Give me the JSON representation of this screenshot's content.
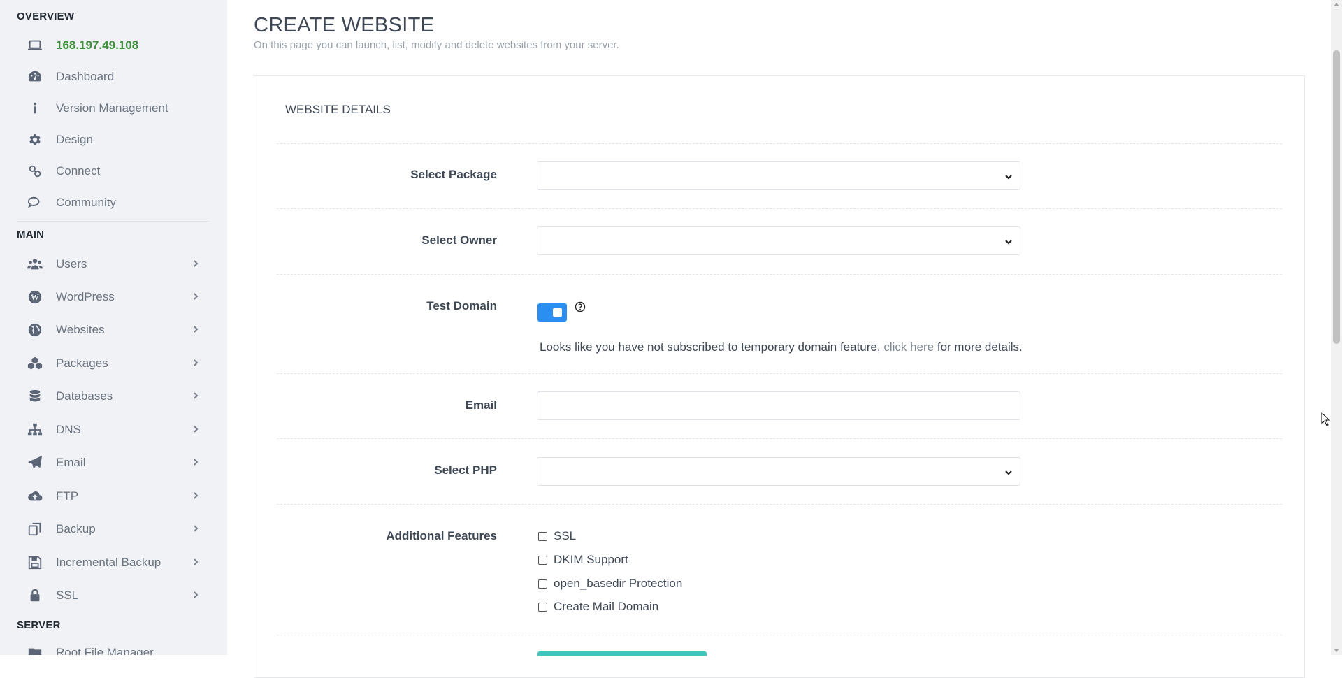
{
  "sidebar": {
    "sections": {
      "overview": "OVERVIEW",
      "main": "MAIN",
      "server": "SERVER"
    },
    "overview_items": [
      {
        "label": "168.197.49.108",
        "icon": "laptop-icon"
      },
      {
        "label": "Dashboard",
        "icon": "dashboard-gauge-icon"
      },
      {
        "label": "Version Management",
        "icon": "info-icon"
      },
      {
        "label": "Design",
        "icon": "gear-icon"
      },
      {
        "label": "Connect",
        "icon": "link-icon"
      },
      {
        "label": "Community",
        "icon": "comments-icon"
      }
    ],
    "main_items": [
      {
        "label": "Users",
        "icon": "users-icon"
      },
      {
        "label": "WordPress",
        "icon": "wordpress-icon"
      },
      {
        "label": "Websites",
        "icon": "globe-icon"
      },
      {
        "label": "Packages",
        "icon": "cubes-icon"
      },
      {
        "label": "Databases",
        "icon": "database-icon"
      },
      {
        "label": "DNS",
        "icon": "sitemap-icon"
      },
      {
        "label": "Email",
        "icon": "paper-plane-icon"
      },
      {
        "label": "FTP",
        "icon": "cloud-upload-icon"
      },
      {
        "label": "Backup",
        "icon": "copy-icon"
      },
      {
        "label": "Incremental Backup",
        "icon": "save-icon"
      },
      {
        "label": "SSL",
        "icon": "lock-icon"
      }
    ],
    "server_items": [
      {
        "label": "Root File Manager",
        "icon": "folder-icon"
      }
    ]
  },
  "page": {
    "title": "CREATE WEBSITE",
    "subtitle": "On this page you can launch, list, modify and delete websites from your server."
  },
  "panel": {
    "title": "WEBSITE DETAILS",
    "select_package_label": "Select Package",
    "select_package_value": "",
    "select_owner_label": "Select Owner",
    "select_owner_value": "",
    "test_domain_label": "Test Domain",
    "test_domain_enabled": true,
    "notice_prefix": "Looks like you have not subscribed to temporary domain feature, ",
    "notice_link": "click here",
    "notice_suffix": " for more details.",
    "email_label": "Email",
    "email_value": "",
    "select_php_label": "Select PHP",
    "select_php_value": "",
    "additional_features_label": "Additional Features",
    "features": [
      {
        "label": "SSL",
        "checked": false
      },
      {
        "label": "DKIM Support",
        "checked": false
      },
      {
        "label": "open_basedir Protection",
        "checked": false
      },
      {
        "label": "Create Mail Domain",
        "checked": false
      }
    ]
  },
  "colors": {
    "toggle": "#2b8ef1",
    "ip_text": "#3d8f3b",
    "submit": "#3ec4b8"
  }
}
